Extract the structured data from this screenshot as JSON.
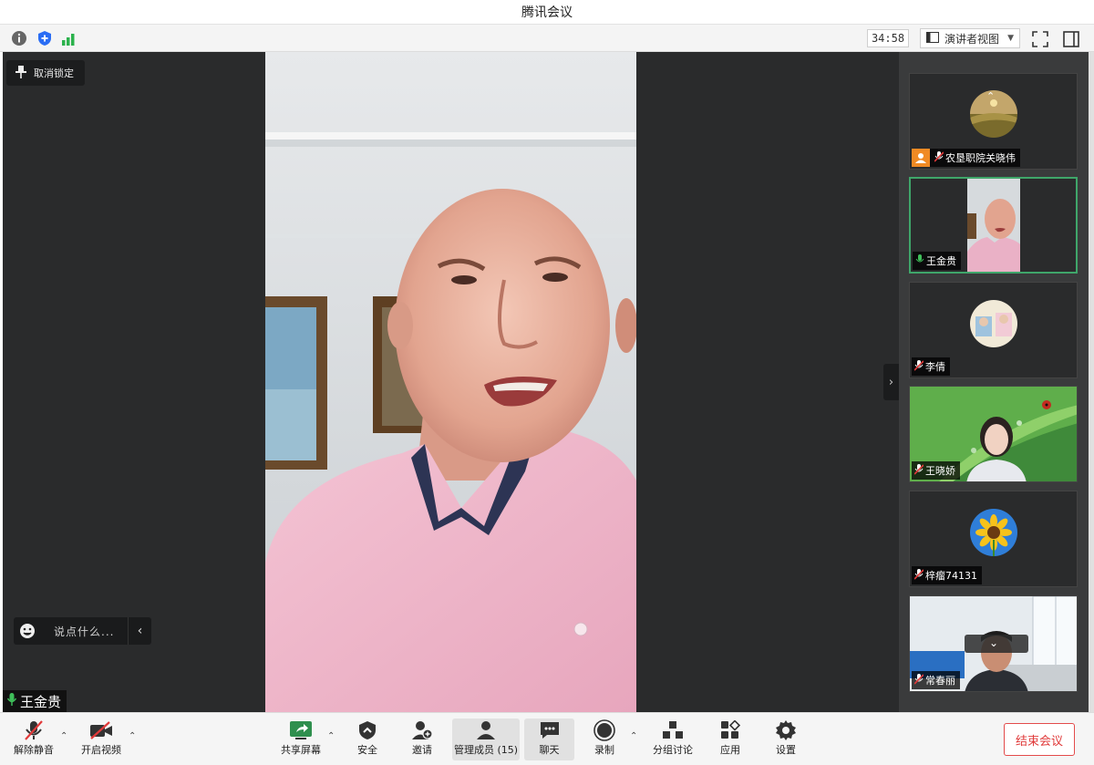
{
  "window": {
    "title": "腾讯会议"
  },
  "infobar": {
    "timer": "34:58",
    "view_mode": "演讲者视图"
  },
  "stage": {
    "pin_label": "取消锁定",
    "chat_placeholder": "说点什么...",
    "active_speaker": "王金贵"
  },
  "participants": [
    {
      "name": "农垦职院关晓伟",
      "muted": true
    },
    {
      "name": "王金贵",
      "muted": false
    },
    {
      "name": "李倩",
      "muted": true
    },
    {
      "name": "王晓娇",
      "muted": true
    },
    {
      "name": "梓瘤74131",
      "muted": true
    },
    {
      "name": "常春丽",
      "muted": true
    }
  ],
  "toolbar": {
    "unmute": "解除静音",
    "video": "开启视频",
    "share": "共享屏幕",
    "security": "安全",
    "invite": "邀请",
    "members": "管理成员 (15)",
    "chat": "聊天",
    "record": "录制",
    "breakout": "分组讨论",
    "apps": "应用",
    "settings": "设置",
    "end": "结束会议"
  },
  "colors": {
    "accent_green": "#3fa66a",
    "danger": "#e03a3a",
    "stage_bg": "#2a2b2c"
  }
}
